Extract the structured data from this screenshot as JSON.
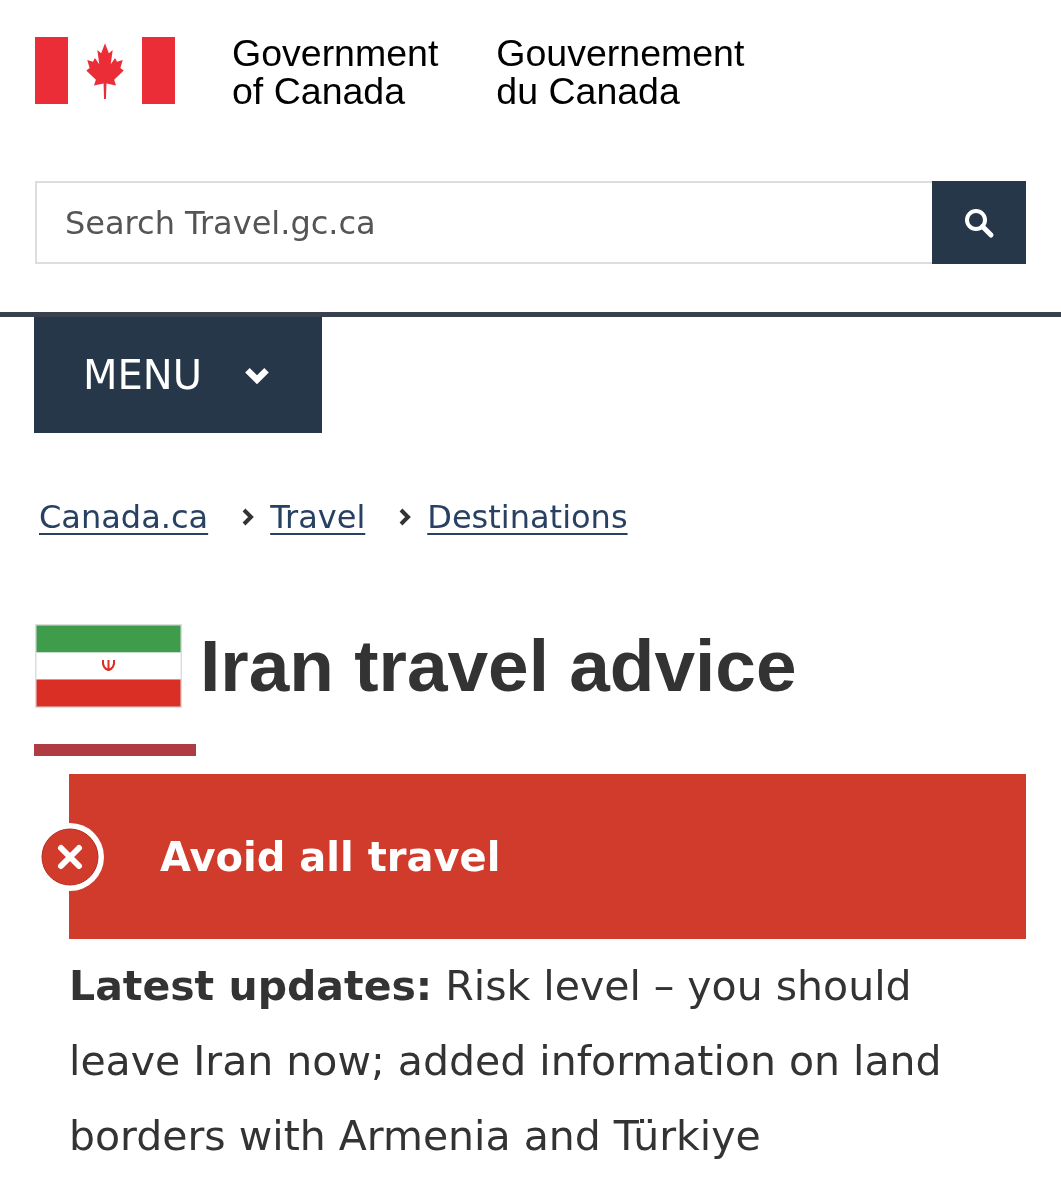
{
  "header": {
    "wordmark_en": [
      "Government",
      "of Canada"
    ],
    "wordmark_fr": [
      "Gouvernement",
      "du Canada"
    ]
  },
  "search": {
    "placeholder": "Search Travel.gc.ca"
  },
  "menu": {
    "label": "MENU",
    "expanded": false
  },
  "breadcrumbs": [
    {
      "label": "Canada.ca"
    },
    {
      "label": "Travel"
    },
    {
      "label": "Destinations"
    }
  ],
  "title": "Iran travel advice",
  "risk": {
    "kind": "avoid_all",
    "label": "Avoid all travel"
  },
  "latest_updates": "**Latest updates:** Risk level – you should leave Iran now; added information on land borders with Armenia and Türkiye"
}
